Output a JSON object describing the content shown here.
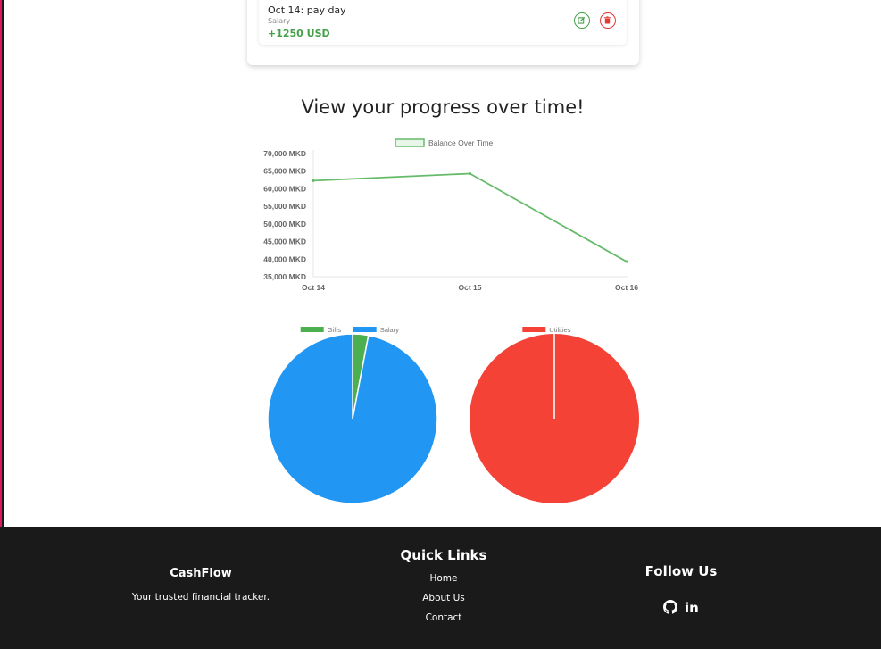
{
  "transaction": {
    "title": "Oct 14: pay day",
    "category": "Salary",
    "amount": "+1250 USD"
  },
  "progress": {
    "heading": "View your progress over time!"
  },
  "chart_data": [
    {
      "type": "line",
      "legend": [
        "Balance Over Time"
      ],
      "legend_position": "top",
      "categories": [
        "Oct 14",
        "Oct 15",
        "Oct 16"
      ],
      "series": [
        {
          "name": "Balance Over Time",
          "values": [
            62300,
            64300,
            39300
          ]
        }
      ],
      "ylim": [
        35000,
        70000
      ],
      "y_ticks": [
        "70,000 MKD",
        "65,000 MKD",
        "60,000 MKD",
        "55,000 MKD",
        "50,000 MKD",
        "45,000 MKD",
        "40,000 MKD",
        "35,000 MKD"
      ],
      "y_tick_values": [
        70000,
        65000,
        60000,
        55000,
        50000,
        45000,
        40000,
        35000
      ],
      "color": "#66bb6a",
      "grid": false
    },
    {
      "type": "pie",
      "legend": [
        "Gifts",
        "Salary"
      ],
      "legend_position": "top",
      "labels": [
        "Gifts",
        "Salary"
      ],
      "values": [
        3,
        97
      ],
      "colors": [
        "#4caf50",
        "#2196f3"
      ]
    },
    {
      "type": "pie",
      "legend": [
        "Utilities"
      ],
      "legend_position": "top",
      "labels": [
        "Utilities"
      ],
      "values": [
        100
      ],
      "colors": [
        "#f44336"
      ]
    }
  ],
  "footer": {
    "brand": "CashFlow",
    "tagline": "Your trusted financial tracker.",
    "quick_links_title": "Quick Links",
    "links": [
      "Home",
      "About Us",
      "Contact"
    ],
    "follow_title": "Follow Us",
    "social_icons": [
      "github-icon",
      "linkedin-icon"
    ],
    "linkedin_text": "in"
  },
  "colors": {
    "accent_green": "#43a047",
    "accent_red": "#e53935",
    "footer_bg": "#1a1a1a"
  }
}
